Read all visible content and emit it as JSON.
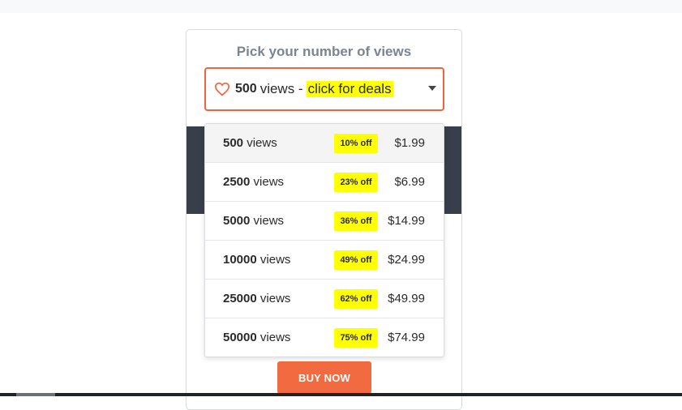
{
  "picker": {
    "title": "Pick your number of views",
    "selected": {
      "count": "500",
      "unit": "views -",
      "deal": "click for deals"
    }
  },
  "options": [
    {
      "count": "500",
      "unit": "views",
      "discount": "10% off",
      "price": "$1.99"
    },
    {
      "count": "2500",
      "unit": "views",
      "discount": "23% off",
      "price": "$6.99"
    },
    {
      "count": "5000",
      "unit": "views",
      "discount": "36% off",
      "price": "$14.99"
    },
    {
      "count": "10000",
      "unit": "views",
      "discount": "49% off",
      "price": "$24.99"
    },
    {
      "count": "25000",
      "unit": "views",
      "discount": "62% off",
      "price": "$49.99"
    },
    {
      "count": "50000",
      "unit": "views",
      "discount": "75% off",
      "price": "$74.99"
    }
  ],
  "buy_label": "BUY NOW",
  "icons": {
    "select": "heart-icon",
    "caret": "caret-down-icon"
  },
  "colors": {
    "accent": "#f26a3f",
    "highlight": "#ffff00",
    "title": "#7b8591",
    "band": "#383f4b"
  }
}
